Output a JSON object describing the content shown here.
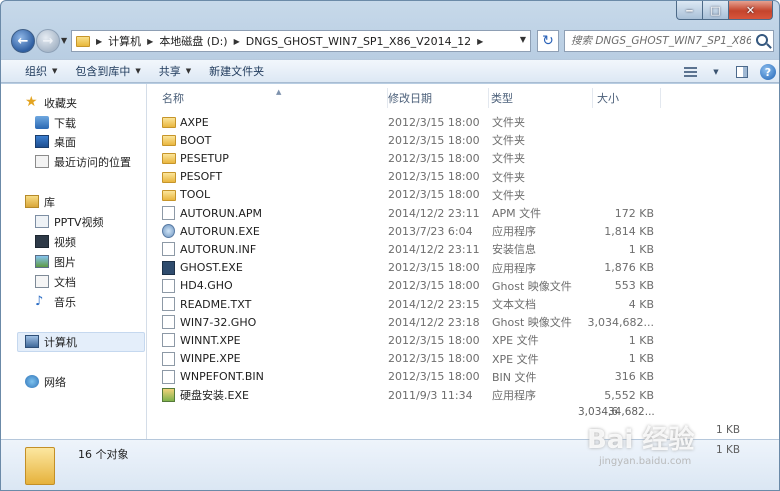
{
  "window": {
    "controls": {
      "minimize": "‒",
      "maximize": "□",
      "close": "✕"
    }
  },
  "address": {
    "crumbs": [
      "计算机",
      "本地磁盘 (D:)",
      "DNGS_GHOST_WIN7_SP1_X86_V2014_12"
    ]
  },
  "search": {
    "placeholder": "搜索 DNGS_GHOST_WIN7_SP1_X86..."
  },
  "toolbar": {
    "organize": "组织",
    "include_library": "包含到库中",
    "share": "共享",
    "new_folder": "新建文件夹"
  },
  "sidebar": {
    "favorites": "收藏夹",
    "downloads": "下载",
    "desktop": "桌面",
    "recent": "最近访问的位置",
    "libraries": "库",
    "pptv": "PPTV视频",
    "videos": "视频",
    "pictures": "图片",
    "documents": "文档",
    "music": "音乐",
    "computer": "计算机",
    "network": "网络"
  },
  "columns": {
    "name": "名称",
    "date": "修改日期",
    "type": "类型",
    "size": "大小"
  },
  "files": [
    {
      "name": "AXPE",
      "date": "2012/3/15 18:00",
      "type": "文件夹",
      "size": "",
      "icon": "folder-icon"
    },
    {
      "name": "BOOT",
      "date": "2012/3/15 18:00",
      "type": "文件夹",
      "size": "",
      "icon": "folder-icon"
    },
    {
      "name": "PESETUP",
      "date": "2012/3/15 18:00",
      "type": "文件夹",
      "size": "",
      "icon": "folder-icon"
    },
    {
      "name": "PESOFT",
      "date": "2012/3/15 18:00",
      "type": "文件夹",
      "size": "",
      "icon": "folder-icon"
    },
    {
      "name": "TOOL",
      "date": "2012/3/15 18:00",
      "type": "文件夹",
      "size": "",
      "icon": "folder-icon"
    },
    {
      "name": "AUTORUN.APM",
      "date": "2014/12/2 23:11",
      "type": "APM 文件",
      "size": "172 KB",
      "icon": "file-icon"
    },
    {
      "name": "AUTORUN.EXE",
      "date": "2013/7/23 6:04",
      "type": "应用程序",
      "size": "1,814 KB",
      "icon": "exe-icon"
    },
    {
      "name": "AUTORUN.INF",
      "date": "2014/12/2 23:11",
      "type": "安装信息",
      "size": "1 KB",
      "icon": "file-icon"
    },
    {
      "name": "GHOST.EXE",
      "date": "2012/3/15 18:00",
      "type": "应用程序",
      "size": "1,876 KB",
      "icon": "ghost-icon"
    },
    {
      "name": "HD4.GHO",
      "date": "2012/3/15 18:00",
      "type": "Ghost 映像文件",
      "size": "553 KB",
      "icon": "file-icon"
    },
    {
      "name": "README.TXT",
      "date": "2014/12/2 23:15",
      "type": "文本文档",
      "size": "4 KB",
      "icon": "file-icon"
    },
    {
      "name": "WIN7-32.GHO",
      "date": "2014/12/2 23:18",
      "type": "Ghost 映像文件",
      "size": "3,034,682...",
      "icon": "file-icon"
    },
    {
      "name": "WINNT.XPE",
      "date": "2012/3/15 18:00",
      "type": "XPE 文件",
      "size": "1 KB",
      "icon": "file-icon"
    },
    {
      "name": "WINPE.XPE",
      "date": "2012/3/15 18:00",
      "type": "XPE 文件",
      "size": "1 KB",
      "icon": "file-icon"
    },
    {
      "name": "WNPEFONT.BIN",
      "date": "2012/3/15 18:00",
      "type": "BIN 文件",
      "size": "316 KB",
      "icon": "file-icon"
    },
    {
      "name": "硬盘安装.EXE",
      "date": "2011/9/3 11:34",
      "type": "应用程序",
      "size": "5,552 KB",
      "icon": "setup-icon"
    }
  ],
  "ghost_artifacts": {
    "a": "3,034,6",
    "b": "34,682...",
    "c": "1 KB",
    "d": "1 KB"
  },
  "status": {
    "count": "16 个对象"
  },
  "watermark": {
    "main": "Bai 经验",
    "sub": "jingyan.baidu.com"
  }
}
